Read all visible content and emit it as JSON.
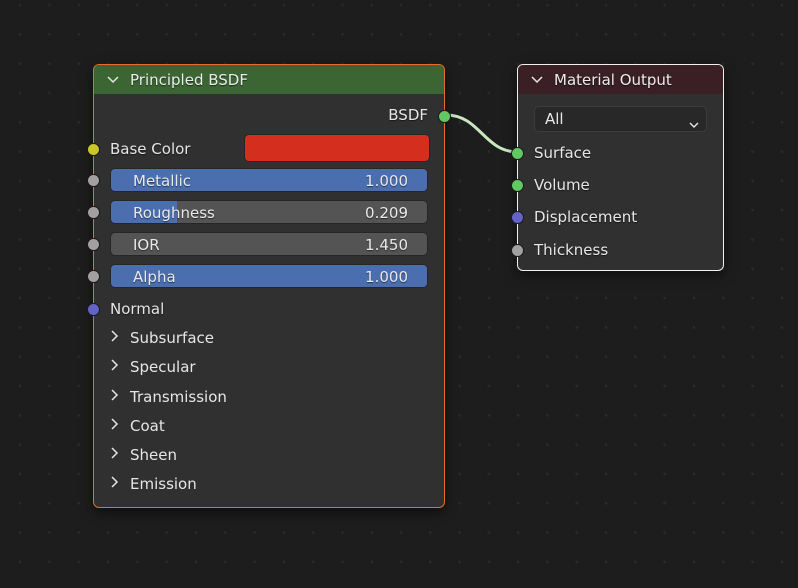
{
  "nodes": {
    "principled_bsdf": {
      "title": "Principled BSDF",
      "header_color": "#3b6634",
      "outputs": [
        {
          "label": "BSDF",
          "socket_color": "#63c763"
        }
      ],
      "base_color": {
        "label": "Base Color",
        "socket_color": "#c7c729",
        "swatch": "#d42f1e"
      },
      "sliders": [
        {
          "label": "Metallic",
          "value": "1.000",
          "fraction": 1.0
        },
        {
          "label": "Roughness",
          "value": "0.209",
          "fraction": 0.209
        },
        {
          "label": "IOR",
          "value": "1.450",
          "fraction": 0.0
        },
        {
          "label": "Alpha",
          "value": "1.000",
          "fraction": 1.0
        }
      ],
      "normal": {
        "label": "Normal",
        "socket_color": "#6363c7"
      },
      "panels": [
        "Subsurface",
        "Specular",
        "Transmission",
        "Coat",
        "Sheen",
        "Emission"
      ]
    },
    "material_output": {
      "title": "Material Output",
      "header_color": "#3a1f25",
      "target": {
        "selected": "All"
      },
      "inputs": [
        {
          "label": "Surface",
          "socket_color": "#63c763"
        },
        {
          "label": "Volume",
          "socket_color": "#63c763"
        },
        {
          "label": "Displacement",
          "socket_color": "#6363c7"
        },
        {
          "label": "Thickness",
          "socket_color": "#a1a1a1"
        }
      ]
    }
  },
  "links": [
    {
      "from": "Principled BSDF.BSDF",
      "to": "Material Output.Surface",
      "color": "#c8e6c0"
    }
  ]
}
